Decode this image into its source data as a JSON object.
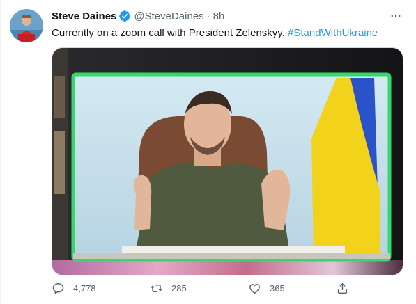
{
  "tweet": {
    "author": {
      "display_name": "Steve Daines",
      "handle": "@SteveDaines",
      "verified": true
    },
    "separator": "·",
    "time": "8h",
    "text": "Currently on a zoom call with President Zelenskyy.",
    "hashtag": "#StandWithUkraine",
    "media": {
      "icon": "photo-of-video-call"
    },
    "actions": {
      "replies": "4,778",
      "retweets": "285",
      "likes": "365"
    }
  },
  "colors": {
    "accent": "#1d9bf0",
    "secondary_text": "#536471",
    "video_frame_green": "#33d96a",
    "flag_yellow": "#f3d21c",
    "flag_blue": "#2a52c9"
  }
}
